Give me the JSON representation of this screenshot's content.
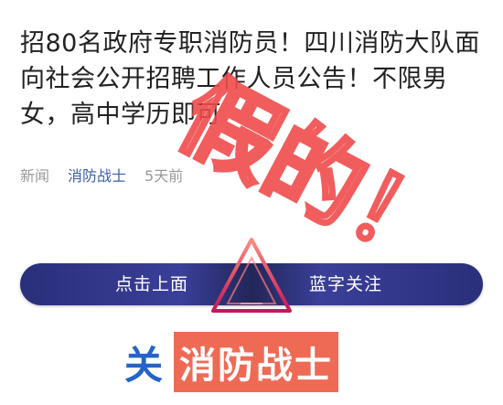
{
  "article": {
    "title": "招80名政府专职消防员！四川消防大队面向社会公开招聘工作人员公告！不限男女，高中学历即可",
    "category": "新闻",
    "author": "消防战士",
    "time": "5天前"
  },
  "stamp": {
    "text": "假的！",
    "color": "#f04c4c"
  },
  "banner": {
    "left_label": "点击上面",
    "right_label": "蓝字关注"
  },
  "footer": {
    "prefix": "关",
    "highlight": "消防战士",
    "highlight_color": "#ef6a55",
    "prefix_color": "#2563c9"
  }
}
